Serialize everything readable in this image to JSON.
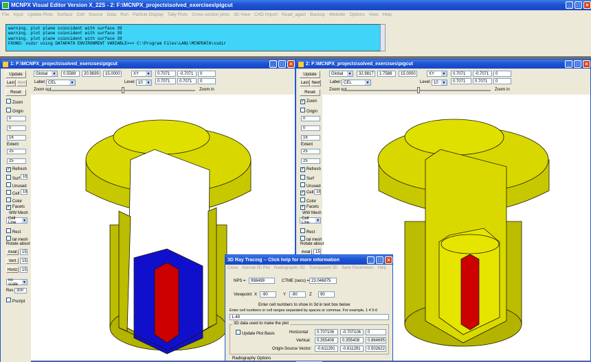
{
  "app": {
    "title": "MCNPX Visual Editor Version X_22S  -  2:  F:\\MCNPX_projects\\solved_exercises\\pigcut"
  },
  "menu": [
    "File",
    "Input",
    "Update Plots",
    "Surface",
    "Cell",
    "Source",
    "Data",
    "Run",
    "Particle Display",
    "Tally Plots",
    "Cross section plots",
    "3D View",
    "CAD Import",
    "Read_again",
    "Backup",
    "Website",
    "Options",
    "View",
    "Help"
  ],
  "messages": [
    "warning.  plot plane coincident with surface     39",
    "warning.  plot plane coincident with surface     39",
    "warning.  plot plane coincident with surface     39",
    "FOUND: xsdir  using DATAPATH ENVIRONMENT VARIABLE==>  C:\\Program Files\\LANL\\MCNPDATA\\xsdir"
  ],
  "win1": {
    "title": "1:  F:\\MCNPX_projects\\solved_exercises\\pigcut",
    "basis": "Global",
    "p1": "0.5569",
    "p2": "20.9839",
    "p3": "15.0000",
    "plane": "XY",
    "v1": "0.7071",
    "v2": "-0.7071",
    "v3": "0",
    "v4": "0.7071",
    "v5": "0.7071",
    "v6": "0",
    "label_prefix": "Label:",
    "label_value": "CEL",
    "level_prefix": "Level:",
    "level_value": "10",
    "zoom_out": "Zoom out",
    "zoom_in": "Zoom in",
    "side": {
      "update": "Update",
      "last": "Last",
      "next": "Next",
      "reset": "Reset",
      "zoom": "Zoom",
      "origin": "Origin",
      "f1": "0",
      "f2": "0",
      "f3": "0",
      "f4": "16",
      "extent": "Extent",
      "e1": "25",
      "e2": "25",
      "refresh": "Refresh",
      "surf": "Surf",
      "surf_v": "16",
      "unused": "Unused",
      "cell": "Cell",
      "cell_v": "18",
      "color": "Color",
      "facets": "Facets",
      "wwmesh": "WW Mesh",
      "cellline": "Cell Line",
      "rect": "Rect",
      "talmesh": "tal mesh",
      "rotate": "Rotate about",
      "axial": "Axial",
      "axial_v": "15",
      "vert": "Vert",
      "vert_v": "15",
      "horiz": "Horiz",
      "horiz_v": "15",
      "noscale": "no scale",
      "res": "Res",
      "res_v": "300",
      "pscript": "Pscript"
    }
  },
  "win2": {
    "title": "2:  F:\\MCNPX_projects\\solved_exercises\\pigcut",
    "basis": "Global",
    "p1": "32.9817",
    "p2": "1.7588",
    "p3": "15.0000",
    "plane": "XY",
    "v1": "0.7071",
    "v2": "-0.7071",
    "v3": "0",
    "v4": "0.7071",
    "v5": "0.7071",
    "v6": "0",
    "label_prefix": "Label:",
    "label_value": "CEL",
    "level_prefix": "Level:",
    "level_value": "10",
    "zoom_out": "Zoom out",
    "zoom_in": "Zoom in",
    "side": {
      "update": "Update",
      "last": "Last",
      "next": "Next",
      "reset": "Reset",
      "zoom": "Zoom",
      "origin": "Origin",
      "f1": "0",
      "f2": "0",
      "f3": "0",
      "f4": "16",
      "extent": "Extent",
      "e1": "25",
      "e2": "25",
      "refresh": "Refresh",
      "surf": "Surf",
      "surf_v": "16",
      "unused": "Unused",
      "cell": "Cell",
      "cell_v": "18",
      "color": "Color",
      "facets": "Facets",
      "wwmesh": "WW Mesh",
      "cellline": "Cell Line",
      "rect": "Rect",
      "talmesh": "tal mesh",
      "rotate": "Rotate about",
      "axial": "Axial",
      "axial_v": "15"
    }
  },
  "raytrace": {
    "title": "3D Ray Tracing  --  Click help for more information",
    "menu": [
      "Close",
      "Normal 3D Plot",
      "Radiographic 3D",
      "Transparent 3D",
      "Save Parameters",
      "Help"
    ],
    "nps_label": "NPS =",
    "nps": "998499",
    "ctime_label": "CTME (secs) =",
    "ctime": "23.046875",
    "viewpoint": "Viewpoint:",
    "x_label": "X",
    "x": "-90",
    "y_label": "Y",
    "y": "-90",
    "z_label": "Z",
    "z": "90",
    "hint1": "Enter cell numbers to show in 3d in text box below",
    "hint2": "Enter cell numbers or cell ranges separated by spaces or commas.  For example, 1 4 5-6",
    "cells": "1-49",
    "group": "3D data used to make the plot",
    "update_basis": "Update Plot Basis",
    "horizontal": "Horizontal",
    "h1": "0.707106",
    "h2": "-0.707106",
    "h3": "0",
    "vertical": "Vertical",
    "vv1": "0.355408",
    "vv2": "0.355408",
    "vv3": "0.864695",
    "origin": "Origin-Source Vector:",
    "o1": "-0.611291",
    "o2": "-0.611291",
    "o3": "0.502622",
    "radio": "Radiography Options"
  },
  "colors": {
    "accent": "#1f55d6",
    "geometry": "#cccc00",
    "fuel": "#cc0000",
    "water": "#1010cc"
  }
}
